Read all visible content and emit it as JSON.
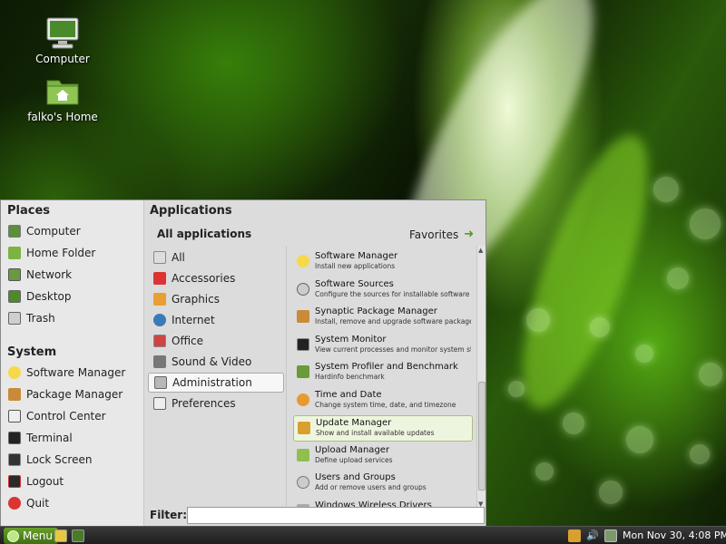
{
  "desktop": {
    "icons": [
      {
        "label": "Computer",
        "icon": "computer-icon"
      },
      {
        "label": "falko's Home",
        "icon": "home-folder-icon"
      }
    ]
  },
  "menu": {
    "places": {
      "title": "Places",
      "items": [
        {
          "label": "Computer",
          "icon": "computer-icon"
        },
        {
          "label": "Home Folder",
          "icon": "home-folder-icon"
        },
        {
          "label": "Network",
          "icon": "network-icon"
        },
        {
          "label": "Desktop",
          "icon": "desktop-icon"
        },
        {
          "label": "Trash",
          "icon": "trash-icon"
        }
      ]
    },
    "system": {
      "title": "System",
      "items": [
        {
          "label": "Software Manager",
          "icon": "software-manager-icon"
        },
        {
          "label": "Package Manager",
          "icon": "package-manager-icon"
        },
        {
          "label": "Control Center",
          "icon": "control-center-icon"
        },
        {
          "label": "Terminal",
          "icon": "terminal-icon"
        },
        {
          "label": "Lock Screen",
          "icon": "lock-icon"
        },
        {
          "label": "Logout",
          "icon": "logout-icon"
        },
        {
          "label": "Quit",
          "icon": "power-icon"
        }
      ]
    },
    "applications": {
      "title": "Applications",
      "subtitle": "All applications",
      "favorites_label": "Favorites",
      "categories": [
        {
          "label": "All",
          "icon": "all-icon"
        },
        {
          "label": "Accessories",
          "icon": "accessories-icon"
        },
        {
          "label": "Graphics",
          "icon": "graphics-icon"
        },
        {
          "label": "Internet",
          "icon": "internet-icon"
        },
        {
          "label": "Office",
          "icon": "office-icon"
        },
        {
          "label": "Sound & Video",
          "icon": "sound-video-icon"
        },
        {
          "label": "Administration",
          "icon": "administration-icon",
          "selected": true
        },
        {
          "label": "Preferences",
          "icon": "preferences-icon"
        }
      ],
      "apps": [
        {
          "name": "Software Manager",
          "desc": "Install new applications",
          "icon": "software-manager-icon"
        },
        {
          "name": "Software Sources",
          "desc": "Configure the sources for installable software and ...",
          "icon": "software-sources-icon"
        },
        {
          "name": "Synaptic Package Manager",
          "desc": "Install, remove and upgrade software packages",
          "icon": "synaptic-icon"
        },
        {
          "name": "System Monitor",
          "desc": "View current processes and monitor system state",
          "icon": "system-monitor-icon"
        },
        {
          "name": "System Profiler and Benchmark",
          "desc": "Hardinfo benchmark",
          "icon": "profiler-icon"
        },
        {
          "name": "Time and Date",
          "desc": "Change system time, date, and timezone",
          "icon": "clock-icon"
        },
        {
          "name": "Update Manager",
          "desc": "Show and install available updates",
          "icon": "update-manager-icon",
          "selected": true
        },
        {
          "name": "Upload Manager",
          "desc": "Define upload services",
          "icon": "upload-manager-icon"
        },
        {
          "name": "Users and Groups",
          "desc": "Add or remove users and groups",
          "icon": "users-groups-icon"
        },
        {
          "name": "Windows Wireless Drivers",
          "desc": "",
          "icon": "wireless-drivers-icon"
        }
      ]
    },
    "filter": {
      "label": "Filter:",
      "value": "",
      "placeholder": ""
    }
  },
  "taskbar": {
    "menu_label": "Menu",
    "clock": "Mon Nov 30,  4:08 PM"
  },
  "colors": {
    "accent_green": "#6aa02a",
    "menu_bg": "#dcdcdc",
    "selected_app_bg": "#eef5df"
  }
}
